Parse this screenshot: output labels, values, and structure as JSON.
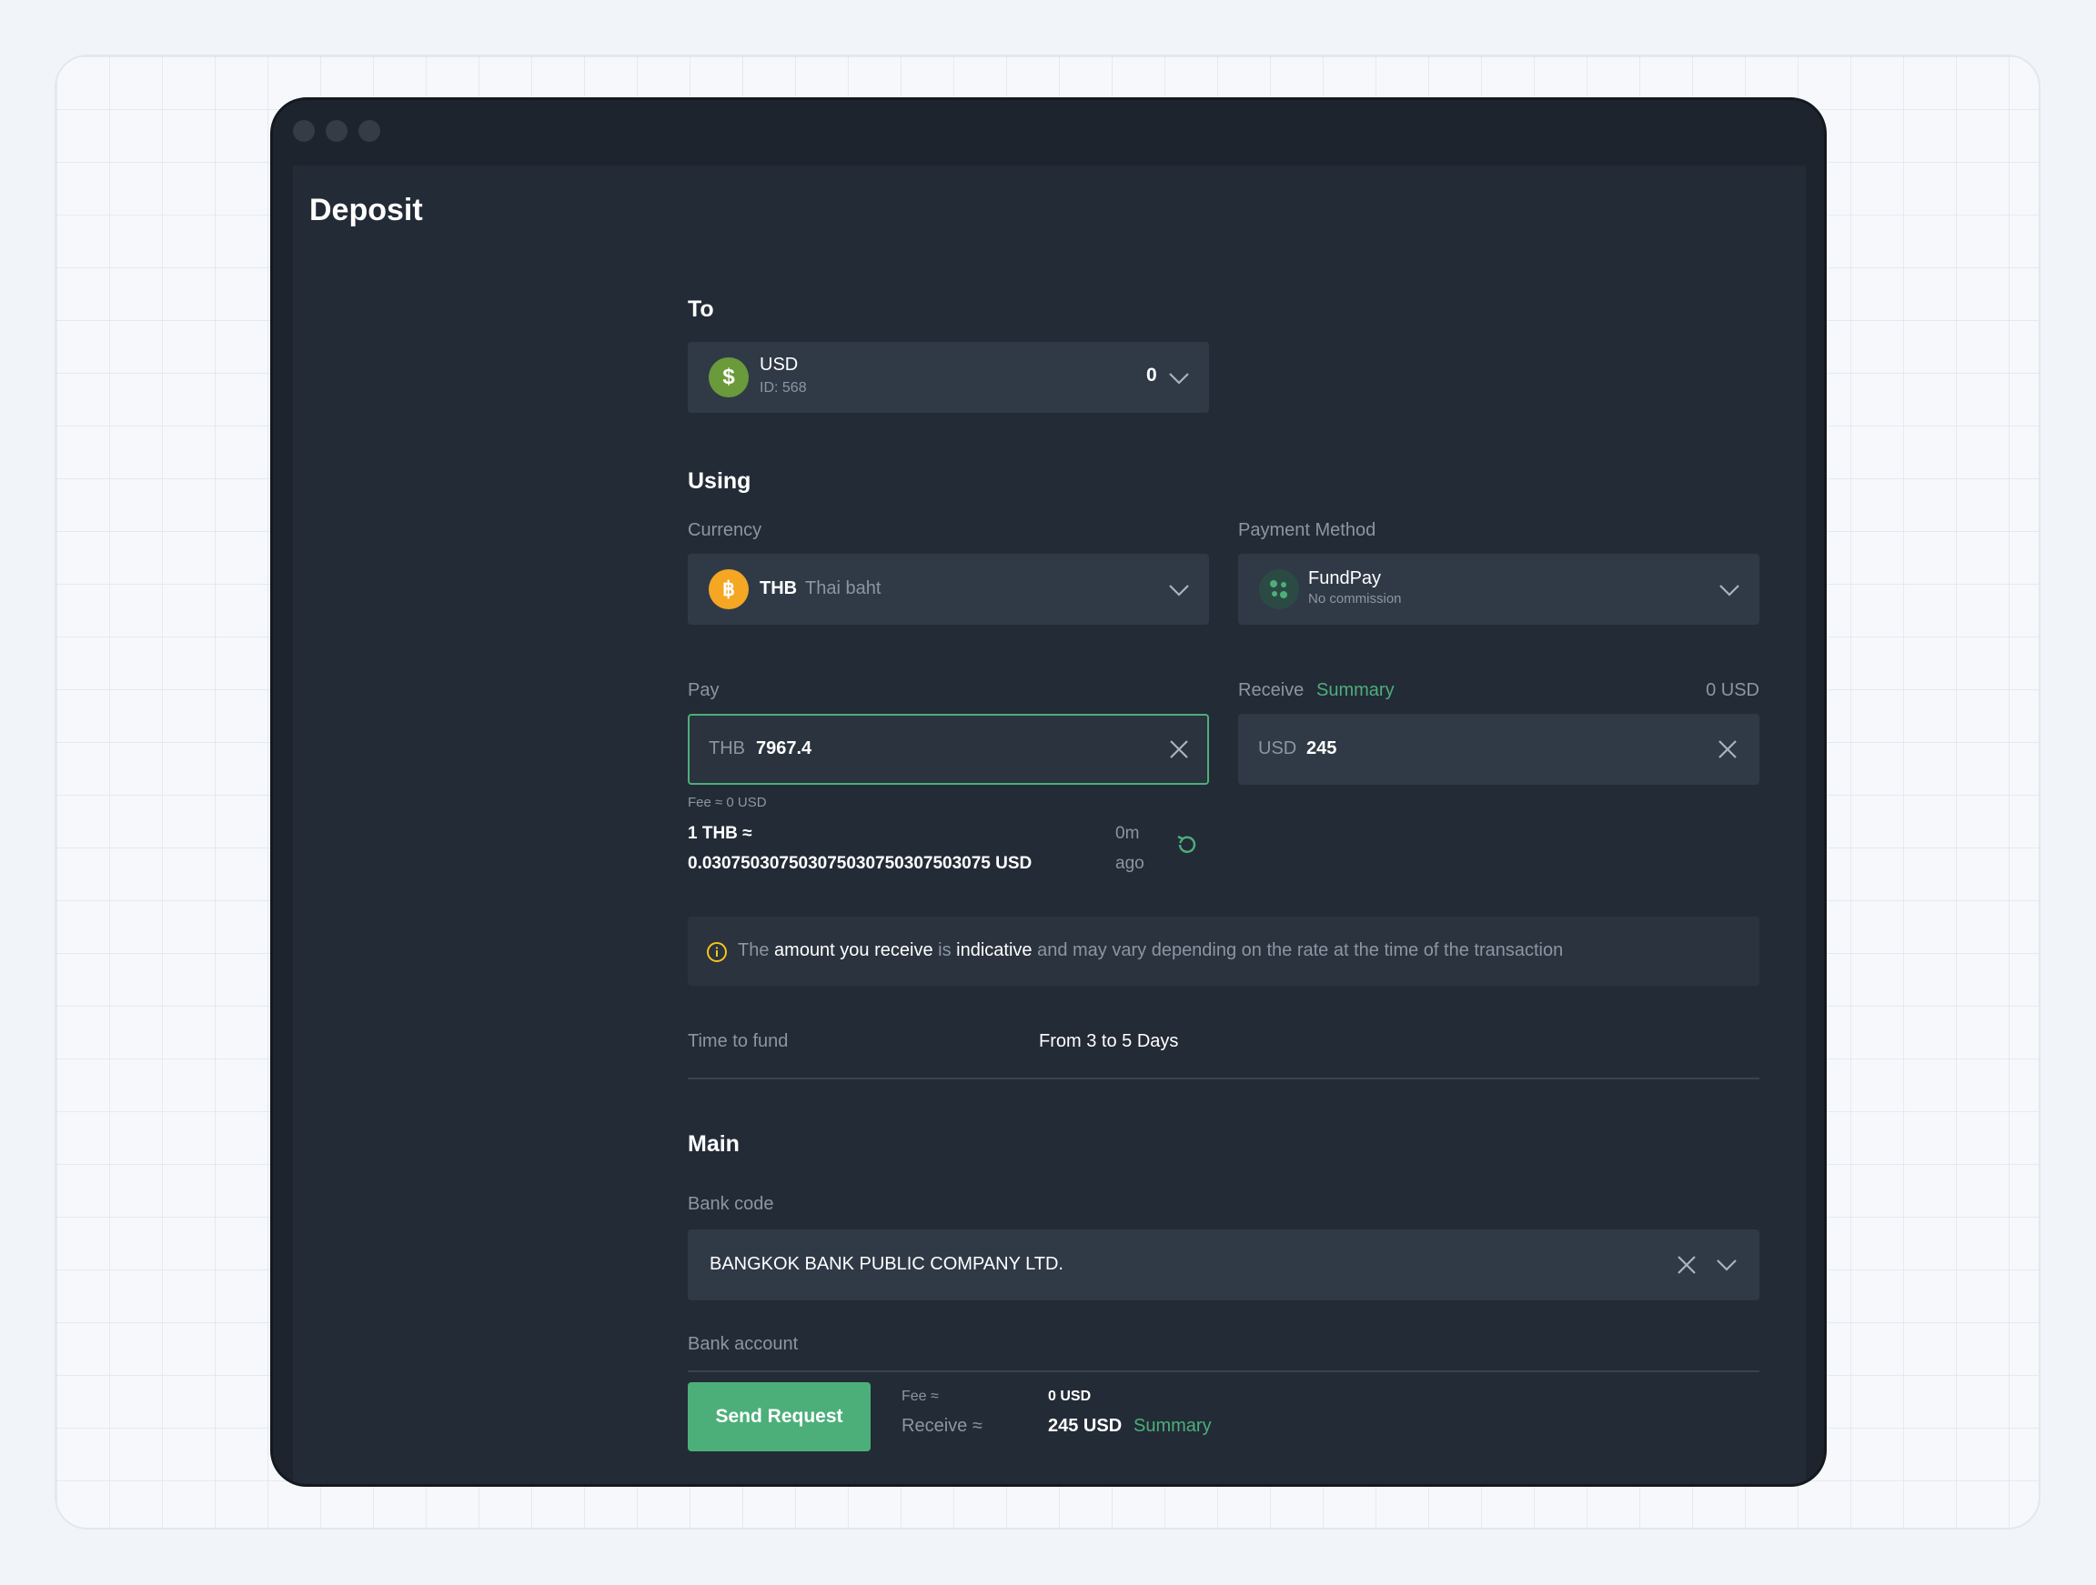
{
  "page": {
    "title": "Deposit"
  },
  "to": {
    "section_label": "To",
    "account_currency": "USD",
    "account_id": "ID: 568",
    "balance": "0",
    "icon": "dollar-icon",
    "icon_color": "#6a9a3a"
  },
  "using": {
    "section_label": "Using",
    "currency_label": "Currency",
    "currency_code": "THB",
    "currency_name": "Thai baht",
    "currency_icon": "baht-icon",
    "currency_icon_color": "#f5a623",
    "method_label": "Payment Method",
    "method_name": "FundPay",
    "method_note": "No commission"
  },
  "amounts": {
    "pay_label": "Pay",
    "pay_currency": "THB",
    "pay_value": "7967.4",
    "receive_label": "Receive",
    "receive_summary_link": "Summary",
    "receive_total": "0 USD",
    "receive_currency": "USD",
    "receive_value": "245",
    "fee_note": "Fee ≈ 0 USD",
    "rate_line1": "1 THB ≈",
    "rate_line2": "0.030750307503075030750307503075 USD",
    "rate_age_1": "0m",
    "rate_age_2": "ago"
  },
  "notice": {
    "p1": "The ",
    "b1": "amount you receive",
    "p2": " is ",
    "b2": "indicative",
    "p3": " and may vary depending on the rate at the time of the transaction"
  },
  "time_to_fund": {
    "label": "Time to fund",
    "value": "From 3 to 5 Days"
  },
  "main": {
    "section_label": "Main",
    "bank_code_label": "Bank code",
    "bank_code_value": "BANGKOK BANK PUBLIC COMPANY LTD.",
    "bank_account_label": "Bank account"
  },
  "footer": {
    "send_button": "Send Request",
    "fee_label": "Fee ≈",
    "fee_value": "0 USD",
    "receive_label": "Receive ≈",
    "receive_value": "245 USD",
    "summary_link": "Summary"
  },
  "colors": {
    "accent": "#4caf7a",
    "warning": "#f5c518"
  }
}
